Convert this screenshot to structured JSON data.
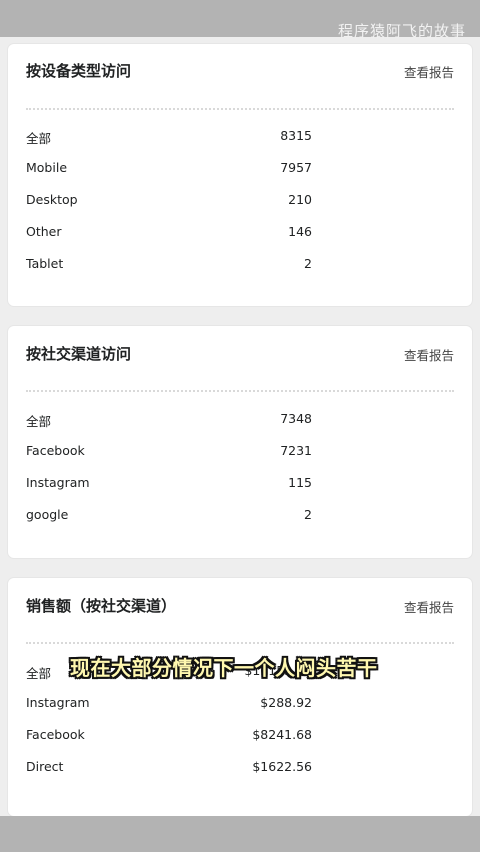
{
  "watermark": "程序猿阿飞的故事",
  "cards": [
    {
      "title": "按设备类型访问",
      "link": "查看报告",
      "rows": [
        {
          "label": "全部",
          "value": "8315"
        },
        {
          "label": "Mobile",
          "value": "7957"
        },
        {
          "label": "Desktop",
          "value": "210"
        },
        {
          "label": "Other",
          "value": "146"
        },
        {
          "label": "Tablet",
          "value": "2"
        }
      ]
    },
    {
      "title": "按社交渠道访问",
      "link": "查看报告",
      "rows": [
        {
          "label": "全部",
          "value": "7348"
        },
        {
          "label": "Facebook",
          "value": "7231"
        },
        {
          "label": "Instagram",
          "value": "115"
        },
        {
          "label": "google",
          "value": "2"
        }
      ]
    },
    {
      "title": "销售额（按社交渠道）",
      "link": "查看报告",
      "rows": [
        {
          "label": "全部",
          "value": "$10153.16"
        },
        {
          "label": "Instagram",
          "value": "$288.92"
        },
        {
          "label": "Facebook",
          "value": "$8241.68"
        },
        {
          "label": "Direct",
          "value": "$1622.56"
        }
      ]
    }
  ],
  "subtitle": "现在大部分情况下一个人闷头苦干"
}
